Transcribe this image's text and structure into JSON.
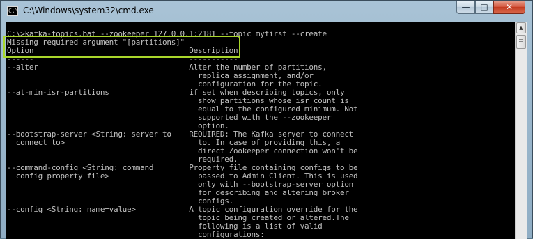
{
  "window": {
    "title": "C:\\Windows\\system32\\cmd.exe",
    "icon_glyph": "C:\\",
    "controls": {
      "minimize": "—",
      "maximize": "□",
      "close": "✕"
    }
  },
  "console": {
    "lines": [
      "C:\\>kafka-topics.bat --zookeeper 127.0.0.1:2181 --topic myfirst --create",
      "Missing required argument \"[partitions]\"",
      "Option                                   Description",
      "------                                   -----------",
      "--alter                                  Alter the number of partitions,",
      "                                           replica assignment, and/or",
      "                                           configuration for the topic.",
      "--at-min-isr-partitions                  if set when describing topics, only",
      "                                           show partitions whose isr count is",
      "                                           equal to the configured minimum. Not",
      "                                           supported with the --zookeeper",
      "                                           option.",
      "--bootstrap-server <String: server to    REQUIRED: The Kafka server to connect",
      "  connect to>                              to. In case of providing this, a",
      "                                           direct Zookeeper connection won't be",
      "                                           required.",
      "--command-config <String: command        Property file containing configs to be",
      "  config property file>                    passed to Admin Client. This is used",
      "                                           only with --bootstrap-server option",
      "                                           for describing and altering broker",
      "                                           configs.",
      "--config <String: name=value>            A topic configuration override for the",
      "                                           topic being created or altered.The",
      "                                           following is a list of valid",
      "                                           configurations:"
    ]
  },
  "annotation": {
    "color": "#a9d62b"
  }
}
